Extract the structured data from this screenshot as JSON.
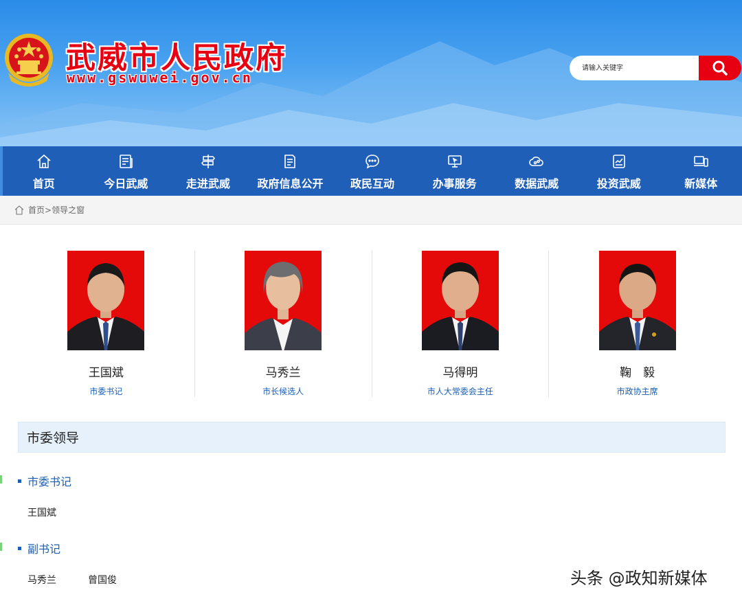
{
  "header": {
    "title": "武威市人民政府",
    "url": "www.gswuwei.gov.cn",
    "emblem_icon": "national-emblem-icon"
  },
  "search": {
    "placeholder": "请输入关键字",
    "button_icon": "search-icon",
    "button_color": "#e60012"
  },
  "nav": {
    "items": [
      {
        "label": "首页",
        "icon": "home-icon"
      },
      {
        "label": "今日武威",
        "icon": "newspaper-icon"
      },
      {
        "label": "走进武威",
        "icon": "signpost-icon"
      },
      {
        "label": "政府信息公开",
        "icon": "document-icon"
      },
      {
        "label": "政民互动",
        "icon": "chat-bubble-icon"
      },
      {
        "label": "办事服务",
        "icon": "monitor-icon"
      },
      {
        "label": "数据武威",
        "icon": "cloud-data-icon"
      },
      {
        "label": "投资武威",
        "icon": "chart-panel-icon"
      },
      {
        "label": "新媒体",
        "icon": "devices-icon"
      }
    ],
    "background": "#1f5fb8"
  },
  "breadcrumb": {
    "home": "首页",
    "separator": ">",
    "current": "领导之窗"
  },
  "leaders": [
    {
      "name": "王国斌",
      "role": "市委书记"
    },
    {
      "name": "马秀兰",
      "role": "市长候选人"
    },
    {
      "name": "马得明",
      "role": "市人大常委会主任"
    },
    {
      "name": "鞠　毅",
      "role": "市政协主席"
    }
  ],
  "section": {
    "title": "市委领导",
    "groups": [
      {
        "title": "市委书记",
        "names": [
          "王国斌"
        ]
      },
      {
        "title": "副书记",
        "names": [
          "马秀兰",
          "曾国俊"
        ]
      }
    ]
  },
  "watermark": "头条 @政知新媒体",
  "colors": {
    "accent_red": "#e60012",
    "link_blue": "#1a5fb4",
    "photo_red": "#e50a0a"
  }
}
